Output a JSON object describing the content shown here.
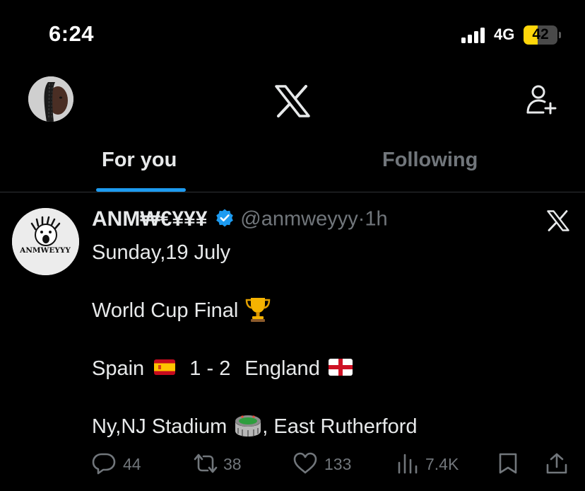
{
  "status_bar": {
    "time": "6:24",
    "network": "4G",
    "battery": "42",
    "battery_level": 0.42,
    "accent": "#ffd60a"
  },
  "header": {
    "logo": "x-logo-icon",
    "avatar": "profile-avatar",
    "follow_icon": "add-person-icon"
  },
  "tabs": [
    {
      "label": "For you",
      "active": true
    },
    {
      "label": "Following",
      "active": false
    }
  ],
  "post": {
    "author": {
      "display_name": "ANM₩€¥¥¥",
      "handle": "@anmweyyy",
      "separator": "·",
      "time": "1h",
      "verified": true,
      "avatar_text": "ANMWEYYY"
    },
    "lines": {
      "date": "Sunday,19 July",
      "headline": "World Cup Final",
      "team1": "Spain",
      "score": "1 - 2",
      "team2": "England",
      "venue": "Ny,NJ Stadium",
      "city": ", East Rutherford"
    },
    "actions": {
      "replies": "44",
      "reposts": "38",
      "likes": "133",
      "views": "7.4K"
    }
  },
  "colors": {
    "background": "#000000",
    "text": "#e7e9ea",
    "muted": "#71767b",
    "accent_blue": "#1d9bf0",
    "divider": "#2f3336"
  }
}
